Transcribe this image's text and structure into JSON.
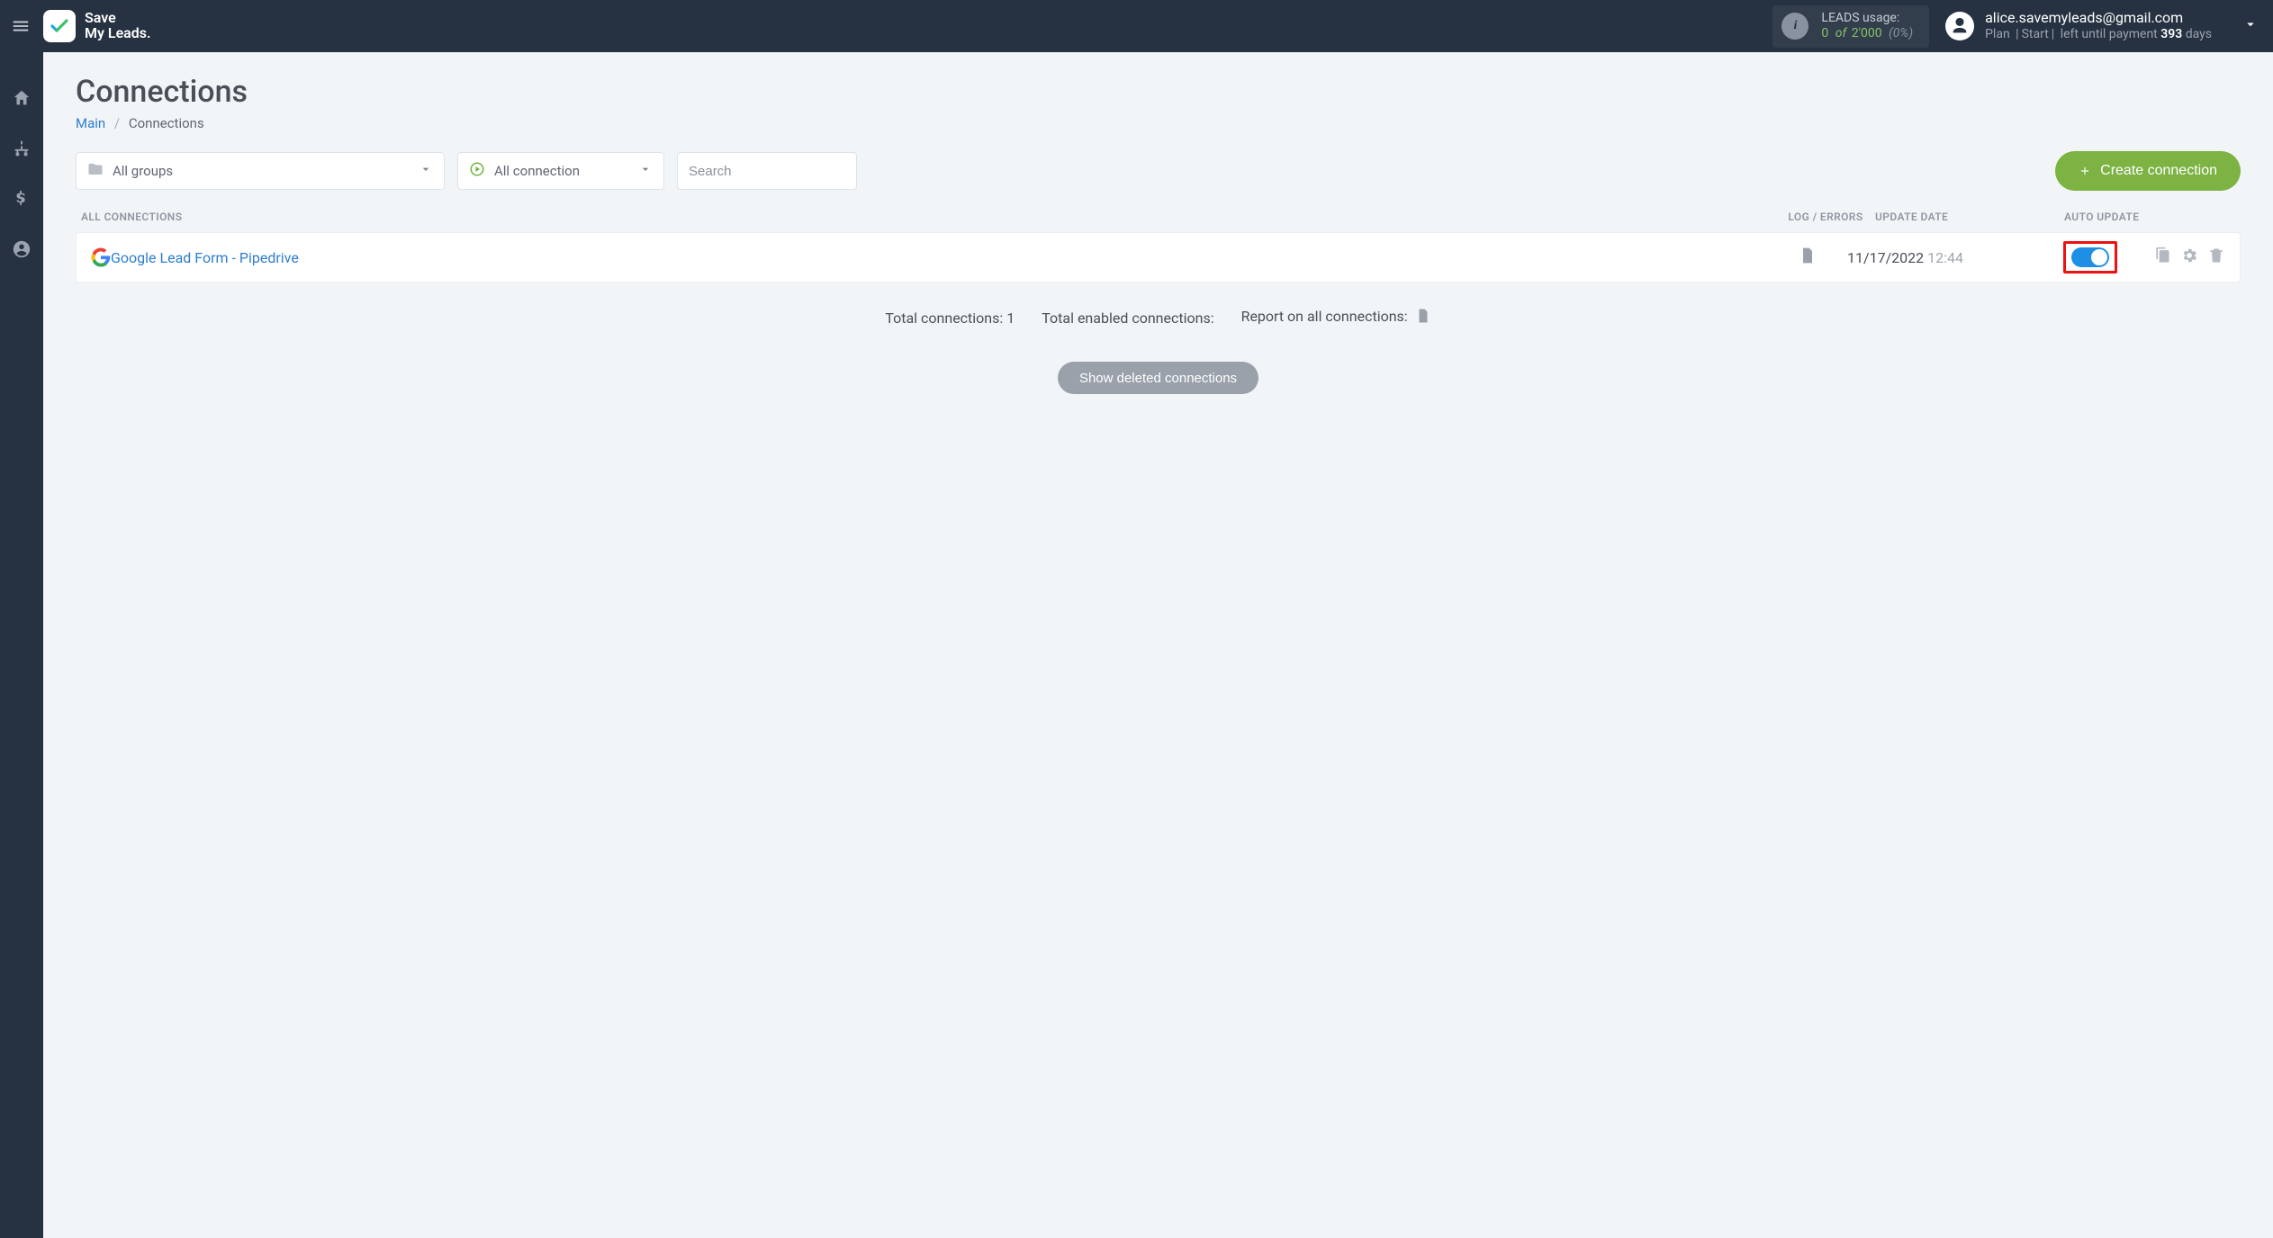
{
  "topbar": {
    "logo_line1": "Save",
    "logo_line2": "My Leads",
    "leads_label": "LEADS usage:",
    "leads_used": "0",
    "leads_of": "of",
    "leads_limit": "2'000",
    "leads_pct": "(0%)",
    "user_email": "alice.savemyleads@gmail.com",
    "plan_label": "Plan",
    "plan_name": "Start",
    "left_until": "left until payment",
    "days_num": "393",
    "days_word": "days"
  },
  "page": {
    "title": "Connections",
    "breadcrumbs": {
      "main": "Main",
      "current": "Connections"
    }
  },
  "filters": {
    "groups": "All groups",
    "connection": "All connection",
    "search_placeholder": "Search",
    "create_label": "Create connection"
  },
  "headers": {
    "all": "All connections",
    "log": "Log / Errors",
    "update": "Update date",
    "auto": "Auto update"
  },
  "rows": [
    {
      "name": "Google Lead Form - Pipedrive",
      "date": "11/17/2022",
      "time": "12:44",
      "auto_update_on": true
    }
  ],
  "summary": {
    "total_conn_label": "Total connections:",
    "total_conn_val": "1",
    "enabled_label": "Total enabled connections:",
    "report_label": "Report on all connections:"
  },
  "show_deleted": "Show deleted connections"
}
